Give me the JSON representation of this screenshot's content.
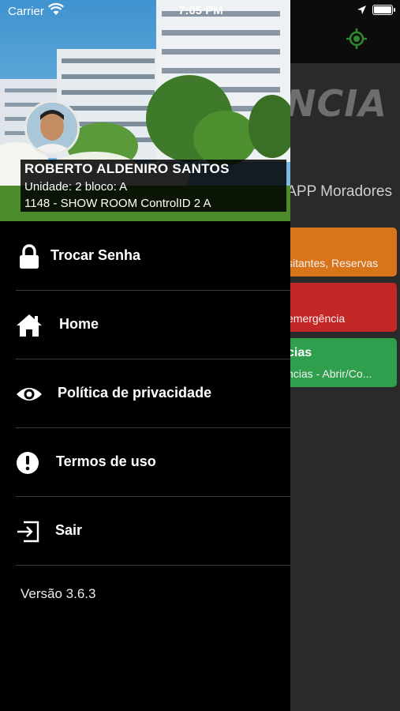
{
  "status_bar": {
    "carrier": "Carrier",
    "time": "7:05 PM"
  },
  "background_app": {
    "logo_text": "NCIA",
    "subtitle": "APP Moradores",
    "cards": [
      {
        "title": "",
        "subtitle": "sitantes, Reservas",
        "color": "#d8741a"
      },
      {
        "title": "",
        "subtitle": "emergência",
        "color": "#c32727"
      },
      {
        "title": "cias",
        "subtitle": "ncias - Abrir/Co...",
        "color": "#2f9e4d"
      }
    ]
  },
  "drawer": {
    "user": {
      "name": "ROBERTO ALDENIRO SANTOS",
      "unit": "Unidade: 2 bloco: A",
      "condo": "1148 - SHOW ROOM ControlID 2 A"
    },
    "menu": [
      {
        "label": "Trocar Senha",
        "icon": "lock-icon"
      },
      {
        "label": "Home",
        "icon": "home-icon"
      },
      {
        "label": "Política de privacidade",
        "icon": "eye-icon"
      },
      {
        "label": "Termos de uso",
        "icon": "exclamation-circle-icon"
      },
      {
        "label": "Sair",
        "icon": "sign-out-icon"
      }
    ],
    "version": "Versão 3.6.3"
  }
}
